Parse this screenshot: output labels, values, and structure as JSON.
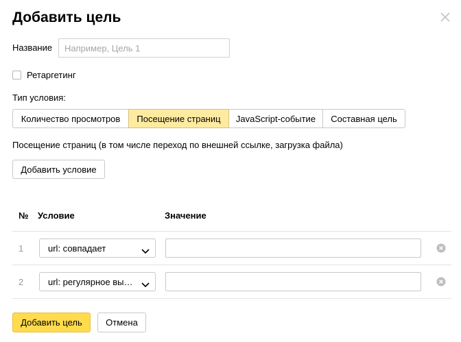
{
  "dialog": {
    "title": "Добавить цель",
    "close_icon": "close-icon"
  },
  "name_field": {
    "label": "Название",
    "placeholder": "Например, Цель 1",
    "value": ""
  },
  "retargeting": {
    "label": "Ретаргетинг",
    "checked": false
  },
  "condition_type": {
    "label": "Тип условия:",
    "options": [
      {
        "label": "Количество просмотров",
        "active": false
      },
      {
        "label": "Посещение страниц",
        "active": true
      },
      {
        "label": "JavaScript-событие",
        "active": false
      },
      {
        "label": "Составная цель",
        "active": false
      }
    ],
    "active_color": "#ffeba0"
  },
  "description": "Посещение страниц (в том числе переход по внешней ссылке, загрузка файла)",
  "add_condition_label": "Добавить условие",
  "table": {
    "headers": {
      "num": "№",
      "condition": "Условие",
      "value": "Значение"
    },
    "rows": [
      {
        "num": "1",
        "condition": "url: совпадает",
        "value": ""
      },
      {
        "num": "2",
        "condition": "url: регулярное вы…",
        "value": ""
      }
    ]
  },
  "footer": {
    "submit_label": "Добавить цель",
    "cancel_label": "Отмена",
    "submit_color": "#ffdb4d"
  }
}
